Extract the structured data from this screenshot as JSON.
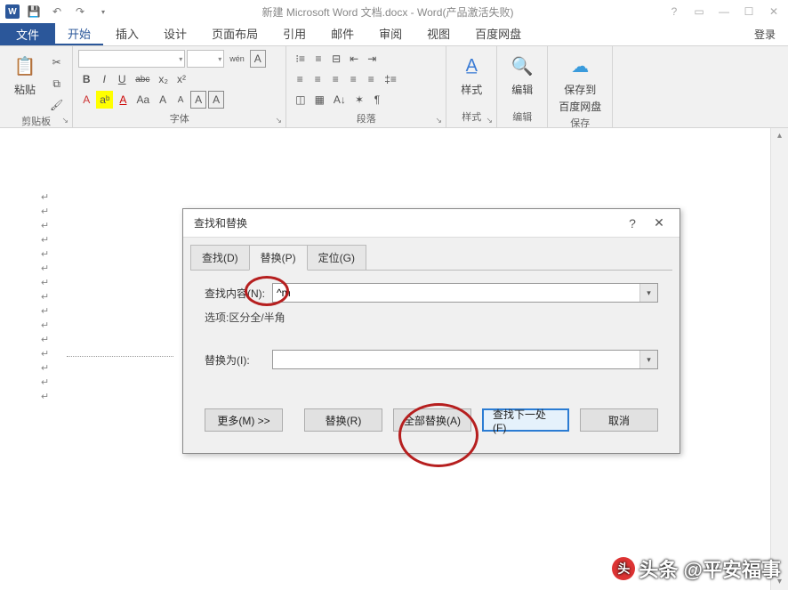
{
  "title": "新建 Microsoft Word 文档.docx - Word(产品激活失败)",
  "tabs": {
    "file": "文件",
    "home": "开始",
    "insert": "插入",
    "design": "设计",
    "layout": "页面布局",
    "references": "引用",
    "mailings": "邮件",
    "review": "审阅",
    "view": "视图",
    "baidu": "百度网盘",
    "login": "登录"
  },
  "ribbon": {
    "clipboard": {
      "label": "剪贴板",
      "paste": "粘贴"
    },
    "font": {
      "label": "字体",
      "family_ph": "",
      "size_ph": "",
      "wen": "wén",
      "bold": "B",
      "italic": "I",
      "underline": "U",
      "strike": "abc",
      "sub": "x₂",
      "sup": "x²",
      "a1": "A",
      "a2": "aᵇ",
      "a3": "A",
      "aa1": "Aa",
      "grow": "A",
      "shrink": "A",
      "caseA": "A",
      "caseAbox": "A"
    },
    "paragraph": {
      "label": "段落"
    },
    "styles": {
      "label": "样式",
      "btn": "样式"
    },
    "editing": {
      "label": "编辑",
      "btn": "编辑"
    },
    "save": {
      "label": "保存",
      "btn1": "保存到",
      "btn2": "百度网盘"
    }
  },
  "dialog": {
    "title": "查找和替换",
    "tab_find": "查找(D)",
    "tab_replace": "替换(P)",
    "tab_goto": "定位(G)",
    "find_label": "查找内容(N):",
    "find_value": "^m",
    "options_label": "选项:",
    "options_value": "区分全/半角",
    "replace_label": "替换为(I):",
    "replace_value": "",
    "more": "更多(M) >>",
    "replace_btn": "替换(R)",
    "replace_all": "全部替换(A)",
    "find_next": "查找下一处(F)",
    "cancel": "取消"
  },
  "watermark": "头条 @平安福事"
}
